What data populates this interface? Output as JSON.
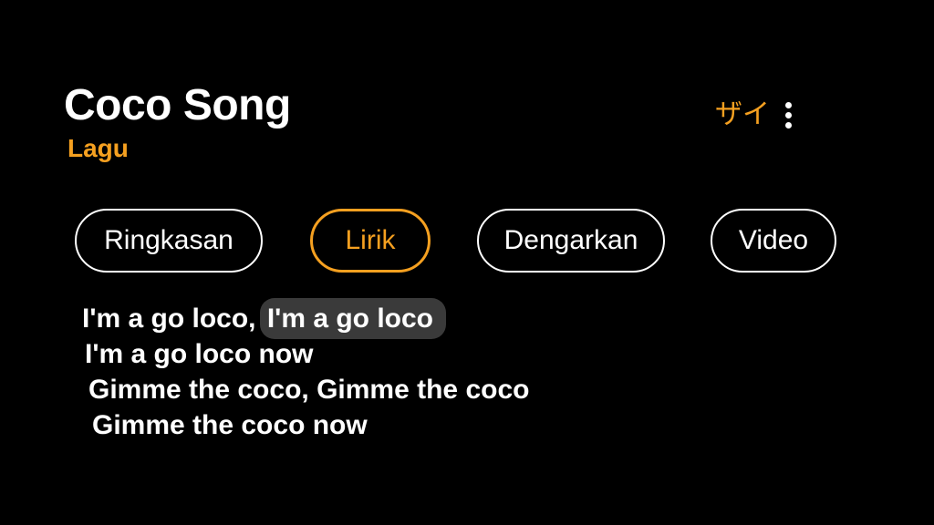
{
  "song": {
    "title": "Coco Song",
    "subtitle": "Lagu"
  },
  "actions": {
    "language_label": "ザイ",
    "more_icon": "more-vert-icon"
  },
  "tabs": [
    {
      "label": "Ringkasan",
      "active": false
    },
    {
      "label": "Lirik",
      "active": true
    },
    {
      "label": "Dengarkan",
      "active": false
    },
    {
      "label": "Video",
      "active": false
    }
  ],
  "lyrics": {
    "line1_start": "I'm a go loco,",
    "line1_highlight": "I'm a go loco",
    "line2": "I'm a go loco now",
    "line3": "Gimme the coco, Gimme the coco",
    "line4": "Gimme the coco now"
  },
  "colors": {
    "background": "#000000",
    "accent": "#f5a020",
    "text": "#ffffff",
    "highlight": "#3a3a3a"
  }
}
